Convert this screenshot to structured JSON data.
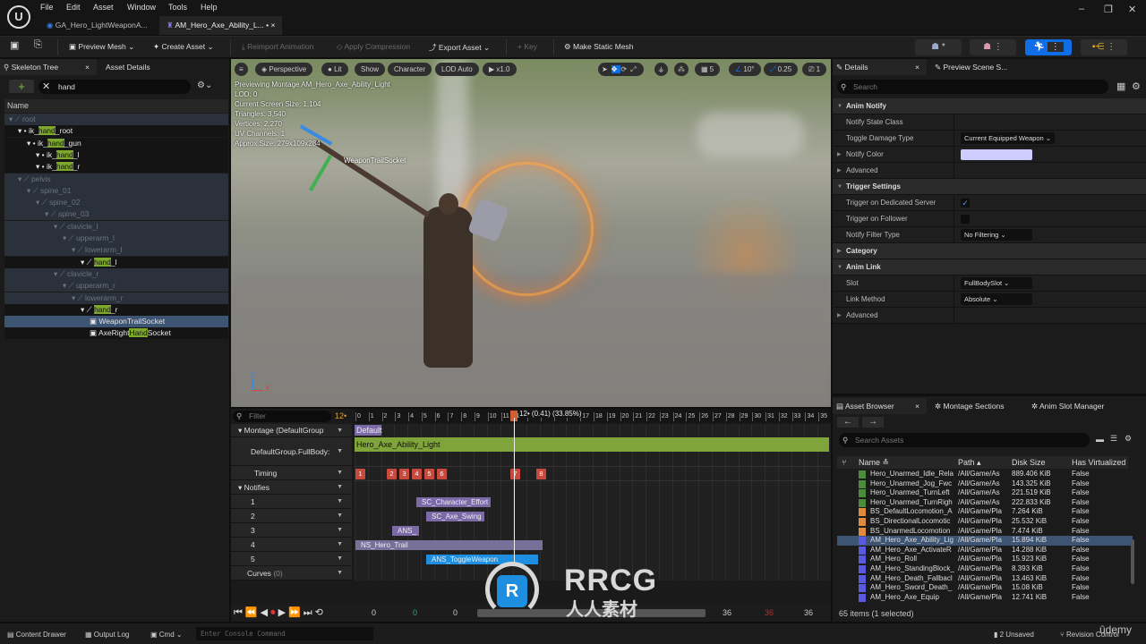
{
  "menu": [
    "File",
    "Edit",
    "Asset",
    "Window",
    "Tools",
    "Help"
  ],
  "doc_tabs": [
    {
      "label": "GA_Hero_LightWeaponA..."
    },
    {
      "label": "AM_Hero_Axe_Ability_L... •",
      "close": "×"
    }
  ],
  "window_controls": {
    "minimize": "–",
    "restore": "❐",
    "close": "✕"
  },
  "toolbar": {
    "preview_mesh": "Preview Mesh ⌄",
    "create_asset": "Create Asset ⌄",
    "reimport": "Reimport Animation",
    "apply_compression": "Apply Compression",
    "export_asset": "Export Asset ⌄",
    "key": "+ Key",
    "make_static_mesh": "Make Static Mesh",
    "mode_badge": "*"
  },
  "skeleton": {
    "tabs": [
      "Skeleton Tree",
      "Asset Details"
    ],
    "close": "×",
    "search_value": "hand",
    "column": "Name",
    "items": [
      {
        "pre": "root",
        "m": "",
        "post": "",
        "depth": 0,
        "dim": true,
        "type": "bone"
      },
      {
        "pre": "ik_",
        "m": "hand",
        "post": "_root",
        "depth": 1,
        "type": "ik"
      },
      {
        "pre": "ik_",
        "m": "hand",
        "post": "_gun",
        "depth": 2,
        "type": "ik"
      },
      {
        "pre": "ik_",
        "m": "hand",
        "post": "_l",
        "depth": 3,
        "type": "ik"
      },
      {
        "pre": "ik_",
        "m": "hand",
        "post": "_r",
        "depth": 3,
        "type": "ik"
      },
      {
        "pre": "pelvis",
        "m": "",
        "post": "",
        "depth": 1,
        "dim": true,
        "type": "bone"
      },
      {
        "pre": "spine_01",
        "m": "",
        "post": "",
        "depth": 2,
        "dim": true,
        "type": "bone"
      },
      {
        "pre": "spine_02",
        "m": "",
        "post": "",
        "depth": 3,
        "dim": true,
        "type": "bone"
      },
      {
        "pre": "spine_03",
        "m": "",
        "post": "",
        "depth": 4,
        "dim": true,
        "type": "bone"
      },
      {
        "pre": "clavicle_l",
        "m": "",
        "post": "",
        "depth": 5,
        "dimtext": true,
        "type": "bone"
      },
      {
        "pre": "upperarm_l",
        "m": "",
        "post": "",
        "depth": 6,
        "dimtext": true,
        "type": "bone"
      },
      {
        "pre": "lowerarm_l",
        "m": "",
        "post": "",
        "depth": 7,
        "dimtext": true,
        "type": "bone"
      },
      {
        "pre": "",
        "m": "hand",
        "post": "_l",
        "depth": 8,
        "type": "bone"
      },
      {
        "pre": "clavicle_r",
        "m": "",
        "post": "",
        "depth": 5,
        "dim": true,
        "type": "bone"
      },
      {
        "pre": "upperarm_r",
        "m": "",
        "post": "",
        "depth": 6,
        "dim": true,
        "type": "bone"
      },
      {
        "pre": "lowerarm_r",
        "m": "",
        "post": "",
        "depth": 7,
        "dim": true,
        "type": "bone"
      },
      {
        "pre": "",
        "m": "hand",
        "post": "_r",
        "depth": 8,
        "type": "bone"
      },
      {
        "pre": "WeaponTrailSocket",
        "m": "",
        "post": "",
        "depth": 9,
        "selected": true,
        "type": "socket"
      },
      {
        "pre": "AxeRight",
        "m": "Hand",
        "post": "Socket",
        "depth": 9,
        "type": "socket"
      }
    ]
  },
  "viewport": {
    "buttons": [
      "≡",
      "Perspective",
      "Lit",
      "Show",
      "Character",
      "LOD Auto",
      "▶ x1.0"
    ],
    "right_tools": {
      "grid": "5",
      "angle": "10°",
      "scale": "0.25",
      "camera": "1"
    },
    "stats": [
      "Previewing Montage AM_Hero_Axe_Ability_Light",
      "LOD: 0",
      "Current Screen Size: 1.104",
      "Triangles: 3,540",
      "Vertices: 2,270",
      "UV Channels: 1",
      "Approx Size: 279x109x284"
    ],
    "socket_label": "WeaponTrailSocket",
    "axis": {
      "z": "Z",
      "x": "X"
    }
  },
  "timeline": {
    "filter_placeholder": "Filter",
    "frame_indicator": "12•",
    "playhead_label": "12• (0.41) (33.85%)",
    "ticks": [
      "0",
      "1",
      "2",
      "3",
      "4",
      "5",
      "6",
      "7",
      "8",
      "9",
      "10",
      "11",
      "12",
      "13",
      "14",
      "15",
      "16",
      "17",
      "18",
      "19",
      "20",
      "21",
      "22",
      "23",
      "24",
      "25",
      "26",
      "27",
      "28",
      "29",
      "30",
      "31",
      "32",
      "33",
      "34",
      "35"
    ],
    "rows": {
      "montage": "Montage (DefaultGroup",
      "slot": "DefaultGroup.FullBody:",
      "timing": "Timing",
      "notifies": "Notifies",
      "tracks": [
        "1",
        "2",
        "3",
        "4",
        "5"
      ],
      "curves": "Curves",
      "curves_count": "(0)"
    },
    "section": "Default",
    "segment": "Hero_Axe_Ability_Light",
    "timing_markers": [
      "1",
      "2",
      "3",
      "4",
      "5",
      "6",
      "7",
      "8"
    ],
    "notifies": [
      "SC_Character_Effort",
      "SC_Axe_Swing",
      "ANS_",
      "NS_Hero_Trail",
      "ANS_ToggleWeapon"
    ],
    "transport_values": [
      "0",
      "0",
      "0",
      "36",
      "36",
      "36"
    ]
  },
  "details": {
    "tabs": [
      "Details",
      "Preview Scene S..."
    ],
    "close": "×",
    "search_placeholder": "Search",
    "rows": [
      {
        "kind": "cat",
        "label": "Anim Notify",
        "open": true
      },
      {
        "kind": "prop",
        "label": "Notify State Class"
      },
      {
        "kind": "prop",
        "label": "Toggle Damage Type",
        "combo": "Current Equipped Weapon ⌄"
      },
      {
        "kind": "prop",
        "label": "Notify Color",
        "color": "#ccccff",
        "expander": true
      },
      {
        "kind": "prop",
        "label": "Advanced",
        "expander": true
      },
      {
        "kind": "cat",
        "label": "Trigger Settings",
        "open": true
      },
      {
        "kind": "prop",
        "label": "Trigger on Dedicated Server",
        "check": true
      },
      {
        "kind": "prop",
        "label": "Trigger on Follower",
        "check": false
      },
      {
        "kind": "prop",
        "label": "Notify Filter Type",
        "combo": "No Filtering ⌄"
      },
      {
        "kind": "cat",
        "label": "Category",
        "open": false
      },
      {
        "kind": "cat",
        "label": "Anim Link",
        "open": true
      },
      {
        "kind": "prop",
        "label": "Slot",
        "combo": "FullBodySlot ⌄"
      },
      {
        "kind": "prop",
        "label": "Link Method",
        "combo": "Absolute ⌄"
      },
      {
        "kind": "prop",
        "label": "Advanced",
        "expander": true
      }
    ]
  },
  "assets": {
    "tabs": [
      "Asset Browser",
      "Montage Sections",
      "Anim Slot Manager"
    ],
    "close": "×",
    "search_placeholder": "Search Assets",
    "columns": [
      "Name",
      "Path",
      "Disk Size",
      "Has Virtualized D"
    ],
    "rows": [
      {
        "name": "Hero_Unarmed_Idle_Rela",
        "path": "/All/Game/As",
        "size": "889.406 KiB",
        "virt": "False",
        "kind": "anim"
      },
      {
        "name": "Hero_Unarmed_Jog_Fwc",
        "path": "/All/Game/As",
        "size": "143.325 KiB",
        "virt": "False",
        "kind": "anim"
      },
      {
        "name": "Hero_Unarmed_TurnLeft",
        "path": "/All/Game/As",
        "size": "221.519 KiB",
        "virt": "False",
        "kind": "anim"
      },
      {
        "name": "Hero_Unarmed_TurnRigh",
        "path": "/All/Game/As",
        "size": "222.833 KiB",
        "virt": "False",
        "kind": "anim"
      },
      {
        "name": "BS_DefaultLocomotion_A",
        "path": "/All/Game/Pla",
        "size": "7.264 KiB",
        "virt": "False",
        "kind": "blend"
      },
      {
        "name": "BS_DirectionalLocomotic",
        "path": "/All/Game/Pla",
        "size": "25.532 KiB",
        "virt": "False",
        "kind": "blend"
      },
      {
        "name": "BS_UnarmedLocomotion",
        "path": "/All/Game/Pla",
        "size": "7.474 KiB",
        "virt": "False",
        "kind": "blend"
      },
      {
        "name": "AM_Hero_Axe_Ability_Lig",
        "path": "/All/Game/Pla",
        "size": "15.894 KiB",
        "virt": "False",
        "kind": "montage",
        "selected": true
      },
      {
        "name": "AM_Hero_Axe_ActivateR",
        "path": "/All/Game/Pla",
        "size": "14.288 KiB",
        "virt": "False",
        "kind": "montage"
      },
      {
        "name": "AM_Hero_Roll",
        "path": "/All/Game/Pla",
        "size": "15.923 KiB",
        "virt": "False",
        "kind": "montage"
      },
      {
        "name": "AM_Hero_StandingBlock_",
        "path": "/All/Game/Pla",
        "size": "8.393 KiB",
        "virt": "False",
        "kind": "montage"
      },
      {
        "name": "AM_Hero_Death_Fallbacl",
        "path": "/All/Game/Pla",
        "size": "13.463 KiB",
        "virt": "False",
        "kind": "montage"
      },
      {
        "name": "AM_Hero_Sword_Death_",
        "path": "/All/Game/Pla",
        "size": "15.08 KiB",
        "virt": "False",
        "kind": "montage"
      },
      {
        "name": "AM_Hero_Axe_Equip",
        "path": "/All/Game/Pla",
        "size": "12.741 KiB",
        "virt": "False",
        "kind": "montage"
      }
    ],
    "count": "65 items (1 selected)",
    "kind_colors": {
      "anim": "#4c8a3c",
      "blend": "#e08a3c",
      "montage": "#5a5ae0"
    }
  },
  "status": {
    "content_drawer": "Content Drawer",
    "output_log": "Output Log",
    "cmd": "Cmd ⌄",
    "console_placeholder": "Enter Console Command",
    "unsaved": "2 Unsaved",
    "revision": "Revision Control"
  },
  "watermark": {
    "text": "RRCG",
    "subtext": "人人素材",
    "udemy": "ûdemy"
  },
  "colors": {
    "accent": "#0f6ee6",
    "selection": "#3d5573",
    "highlight": "#7da82d",
    "segment": "#7fa43a",
    "timing": "#c94a3c",
    "notify": "#7c6aa8",
    "notify_active": "#1e8fe0"
  }
}
